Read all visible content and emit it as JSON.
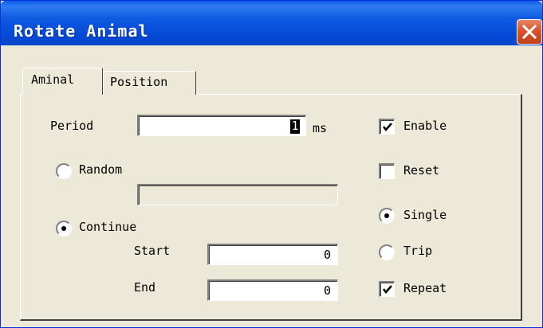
{
  "window": {
    "title": "Rotate Animal"
  },
  "tabs": [
    {
      "label": "Aminal",
      "active": true
    },
    {
      "label": "Position",
      "active": false
    }
  ],
  "period": {
    "label": "Period",
    "value": "1",
    "unit": "ms"
  },
  "mode": {
    "random": {
      "label": "Random",
      "selected": false,
      "value": ""
    },
    "continue": {
      "label": "Continue",
      "selected": true
    },
    "start": {
      "label": "Start",
      "value": "0"
    },
    "end": {
      "label": "End",
      "value": "0"
    }
  },
  "options": {
    "enable": {
      "label": "Enable",
      "checked": true
    },
    "reset": {
      "label": "Reset",
      "checked": false
    },
    "single": {
      "label": "Single",
      "selected": true
    },
    "trip": {
      "label": "Trip",
      "selected": false
    },
    "repeat": {
      "label": "Repeat",
      "checked": true
    }
  }
}
